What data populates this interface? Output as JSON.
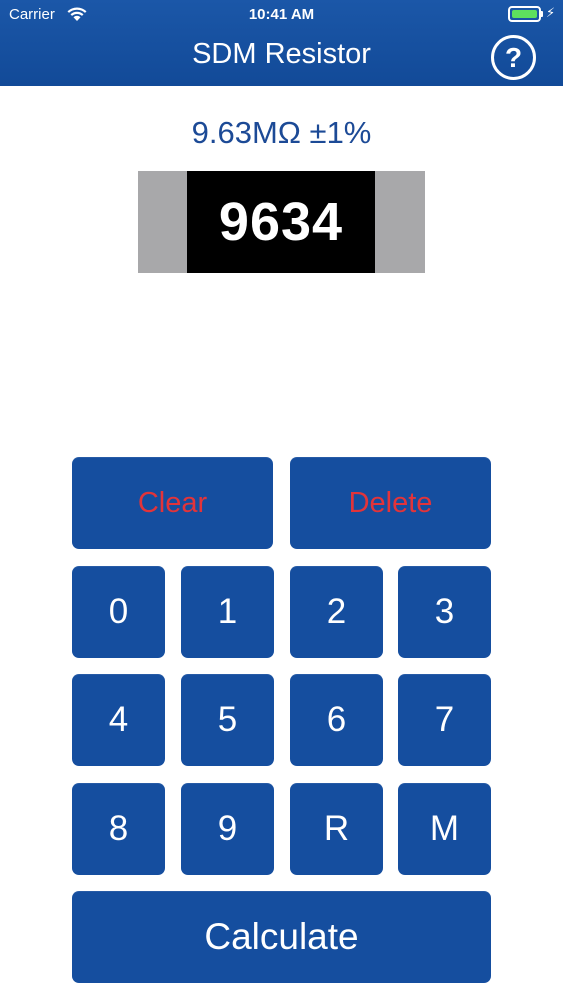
{
  "status_bar": {
    "carrier": "Carrier",
    "time": "10:41 AM",
    "battery_color": "#5ee05e"
  },
  "header": {
    "title": "SDM Resistor",
    "help_label": "?",
    "background_color": "#124a98"
  },
  "result": {
    "value_text": "9.63MΩ ±1%",
    "code": "9634"
  },
  "keypad": {
    "clear_label": "Clear",
    "delete_label": "Delete",
    "keys": [
      "0",
      "1",
      "2",
      "3",
      "4",
      "5",
      "6",
      "7",
      "8",
      "9",
      "R",
      "M"
    ],
    "calculate_label": "Calculate",
    "action_text_color": "#e2343a"
  },
  "icons": [
    "wifi-icon",
    "battery-icon",
    "charging-bolt-icon",
    "help-icon"
  ]
}
